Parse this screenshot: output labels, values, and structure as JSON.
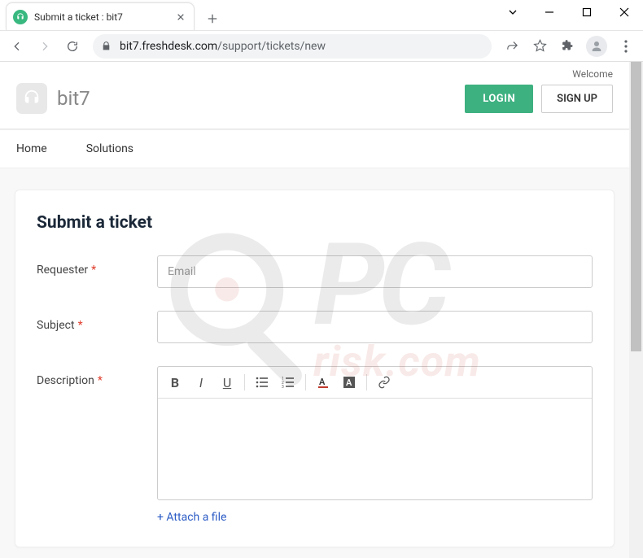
{
  "browser": {
    "tab_title": "Submit a ticket : bit7",
    "url_domain": "bit7.freshdesk.com",
    "url_path": "/support/tickets/new"
  },
  "header": {
    "welcome": "Welcome",
    "brand": "bit7",
    "login": "LOGIN",
    "signup": "SIGN UP"
  },
  "nav": {
    "home": "Home",
    "solutions": "Solutions"
  },
  "form": {
    "title": "Submit a ticket",
    "requester_label": "Requester",
    "requester_placeholder": "Email",
    "subject_label": "Subject",
    "description_label": "Description",
    "attach": "+ Attach a file",
    "required_mark": "*"
  },
  "watermark": {
    "top": "PC",
    "bottom": "risk.com"
  }
}
